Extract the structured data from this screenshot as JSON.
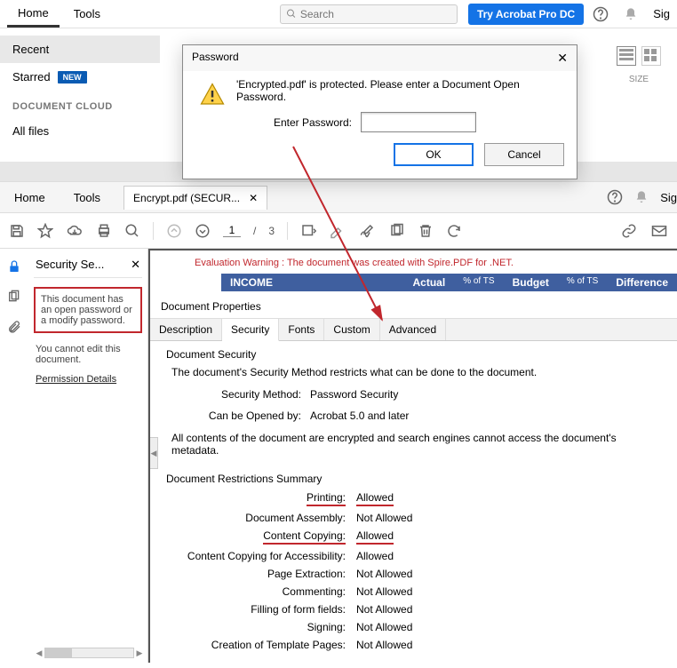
{
  "top": {
    "home": "Home",
    "tools": "Tools",
    "search_ph": "Search",
    "try": "Try Acrobat Pro DC",
    "sign": "Sig"
  },
  "nav": {
    "recent": "Recent",
    "starred": "Starred",
    "new": "NEW",
    "cloud_hdr": "DOCUMENT CLOUD",
    "all_files": "All files",
    "size": "SIZE"
  },
  "password_dialog": {
    "title": "Password",
    "message": "'Encrypted.pdf' is protected. Please enter a Document Open Password.",
    "label": "Enter Password:",
    "value": "",
    "ok": "OK",
    "cancel": "Cancel"
  },
  "doc_tabs": {
    "home": "Home",
    "tools": "Tools",
    "filename": "Encrypt.pdf (SECUR...",
    "sign": "Sig"
  },
  "page": {
    "current": "1",
    "sep": "/",
    "total": "3"
  },
  "sec_panel": {
    "title": "Security Se...",
    "red_note": "This document has an open password or a modify password.",
    "edit_note": "You cannot edit this document.",
    "perm_link": "Permission Details"
  },
  "eval_warning": "Evaluation Warning : The document was created with Spire.PDF for .NET.",
  "blue_bar": {
    "income": "INCOME",
    "actual": "Actual",
    "pct1": "% of TS",
    "budget": "Budget",
    "pct2": "% of TS",
    "diff": "Difference"
  },
  "props": {
    "title": "Document Properties",
    "tabs": {
      "description": "Description",
      "security": "Security",
      "fonts": "Fonts",
      "custom": "Custom",
      "advanced": "Advanced"
    },
    "section": "Document Security",
    "intro": "The document's Security Method restricts what can be done to the document.",
    "method_k": "Security Method:",
    "method_v": "Password Security",
    "open_k": "Can be Opened by:",
    "open_v": "Acrobat 5.0 and later",
    "meta": "All contents of the document are encrypted and search engines cannot access the document's metadata.",
    "restr_hdr": "Document Restrictions Summary",
    "rows": [
      {
        "k": "Printing:",
        "v": "Allowed",
        "u": true
      },
      {
        "k": "Document Assembly:",
        "v": "Not Allowed",
        "u": false
      },
      {
        "k": "Content Copying:",
        "v": "Allowed",
        "u": true
      },
      {
        "k": "Content Copying for Accessibility:",
        "v": "Allowed",
        "u": false
      },
      {
        "k": "Page Extraction:",
        "v": "Not Allowed",
        "u": false
      },
      {
        "k": "Commenting:",
        "v": "Not Allowed",
        "u": false
      },
      {
        "k": "Filling of form fields:",
        "v": "Not Allowed",
        "u": false
      },
      {
        "k": "Signing:",
        "v": "Not Allowed",
        "u": false
      },
      {
        "k": "Creation of Template Pages:",
        "v": "Not Allowed",
        "u": false
      }
    ]
  }
}
